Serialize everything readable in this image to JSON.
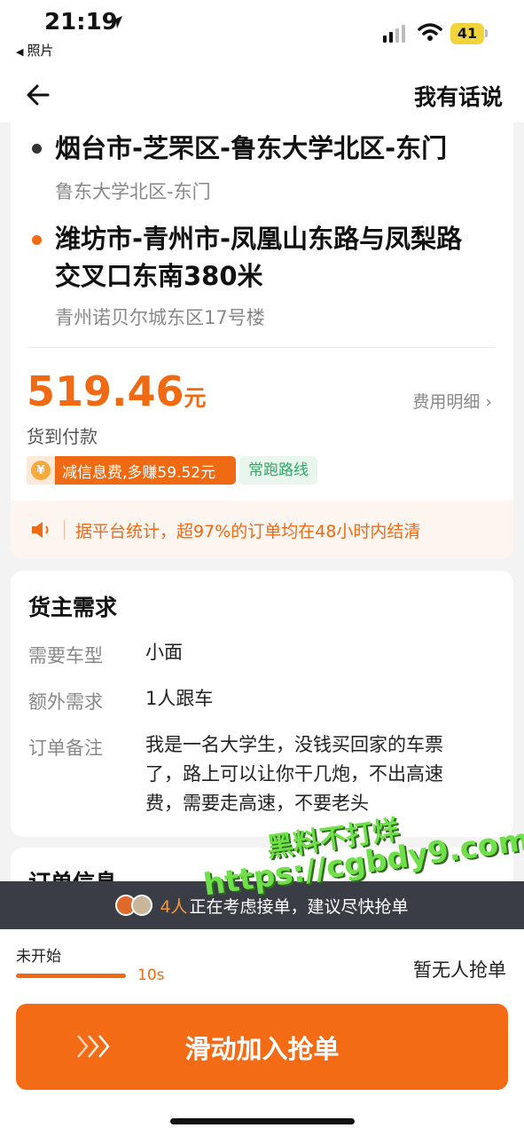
{
  "status_bar": {
    "time": "21:19",
    "back_app": "照片",
    "battery": "41"
  },
  "nav": {
    "right_action": "我有话说"
  },
  "route": {
    "from": {
      "title": "烟台市-芝罘区-鲁东大学北区-东门",
      "sub": "鲁东大学北区-东门"
    },
    "to": {
      "title_line1": "潍坊市-青州市-凤凰山东路与凤梨路",
      "title_line2": "交叉口东南380米",
      "sub": "青州诺贝尔城东区17号楼"
    }
  },
  "price": {
    "amount": "519.46",
    "unit": "元",
    "detail_link": "费用明细",
    "payment": "货到付款"
  },
  "badges": {
    "coin_symbol": "¥",
    "discount": "减信息费,多赚59.52元",
    "route_type": "常跑路线"
  },
  "notice": {
    "text": "据平台统计，超97%的订单均在48小时内结清"
  },
  "demand": {
    "title": "货主需求",
    "rows": [
      {
        "label": "需要车型",
        "value": "小面"
      },
      {
        "label": "额外需求",
        "value": "1人跟车"
      },
      {
        "label": "订单备注",
        "value_line1": "我是一名大学生，没钱买回家的车票",
        "value_line2": "了，路上可以让你干几炮，不出高速",
        "value_line3": "费，需要走高速，不要老头"
      }
    ]
  },
  "order_info": {
    "title": "订单信息"
  },
  "watermark": {
    "line1": "黑料不打烊",
    "line2": "https://cgbdy9.com"
  },
  "banner": {
    "count": "4人",
    "text": "正在考虑接单，建议尽快抢单"
  },
  "bottom": {
    "status": "未开始",
    "seconds": "10s",
    "no_grab": "暂无人抢单",
    "slide_label": "滑动加入抢单"
  },
  "colors": {
    "accent": "#f06a13",
    "green": "#2fa866",
    "banner_bg": "#3a3d46"
  }
}
